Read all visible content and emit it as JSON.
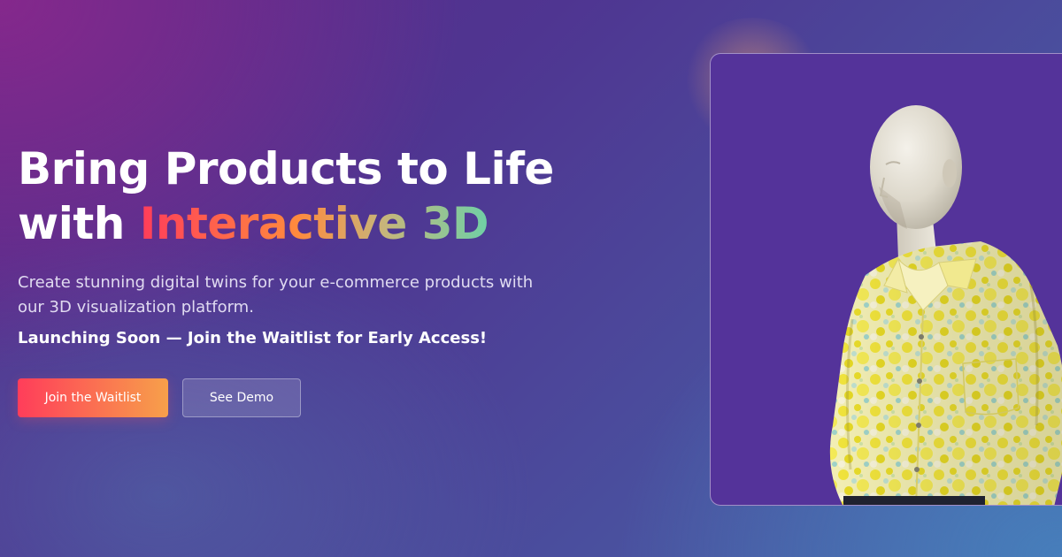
{
  "hero": {
    "headline_line1": "Bring Products to Life",
    "headline_with": "with",
    "headline_highlight": "Interactive 3D",
    "subtitle": "Create stunning digital twins for your e-commerce products with our 3D visualization platform.",
    "launch_text": "Launching Soon — Join the Waitlist for Early Access!"
  },
  "buttons": {
    "primary_label": "Join the Waitlist",
    "secondary_label": "See Demo"
  },
  "colors": {
    "accent_start": "#ff3d5a",
    "accent_end": "#f7a04a",
    "viewer_bg": "#54339a"
  },
  "viewer": {
    "subject": "mannequin-in-yellow-floral-shirt"
  }
}
